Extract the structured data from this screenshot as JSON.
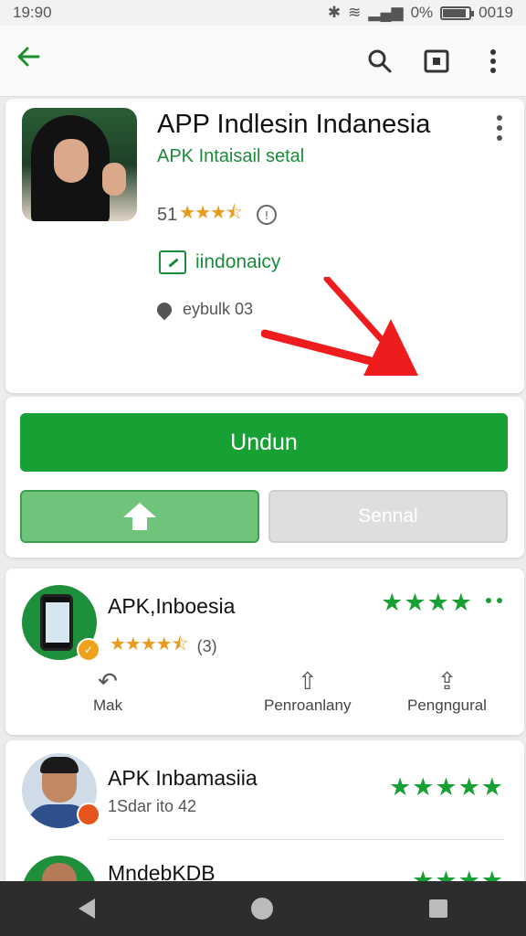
{
  "status_bar": {
    "time": "19:90",
    "battery_text": "0%",
    "clock_right": "0019",
    "battery_level": 0.9
  },
  "toolbar": {
    "back_icon": "arrow-left-icon",
    "search_icon": "search-icon",
    "cast_icon": "cast-icon",
    "more_icon": "more-vert-icon"
  },
  "app": {
    "title": "APP Indlesin Indanesia",
    "subtitle": "APK Intaisail setal",
    "rating": "51",
    "rating_value": 3.5,
    "info_label": "!",
    "badge": "iindonaicy",
    "location": "eybulk 03"
  },
  "actions": {
    "install_label": "Undun",
    "secondary_label": "Sennal"
  },
  "related": [
    {
      "title": "APK,Inboesia",
      "sub": "(3)",
      "green_stars": "★★★★",
      "actions": [
        {
          "icon": "reply-icon",
          "label": "Mak"
        },
        {
          "icon": "share-icon",
          "label": "Penroanlany"
        },
        {
          "icon": "share-icon",
          "label": "Pengngural"
        }
      ]
    },
    {
      "title": "APK Inbamasiia",
      "sub": "1Sdar ito 42",
      "green_stars": "★★★★★"
    },
    {
      "title": "MndebKDB",
      "green_stars": "★★★★"
    }
  ],
  "colors": {
    "accent": "#17a033",
    "arrow": "#ee1c1c",
    "nav_bar": "#2d2d2d"
  }
}
